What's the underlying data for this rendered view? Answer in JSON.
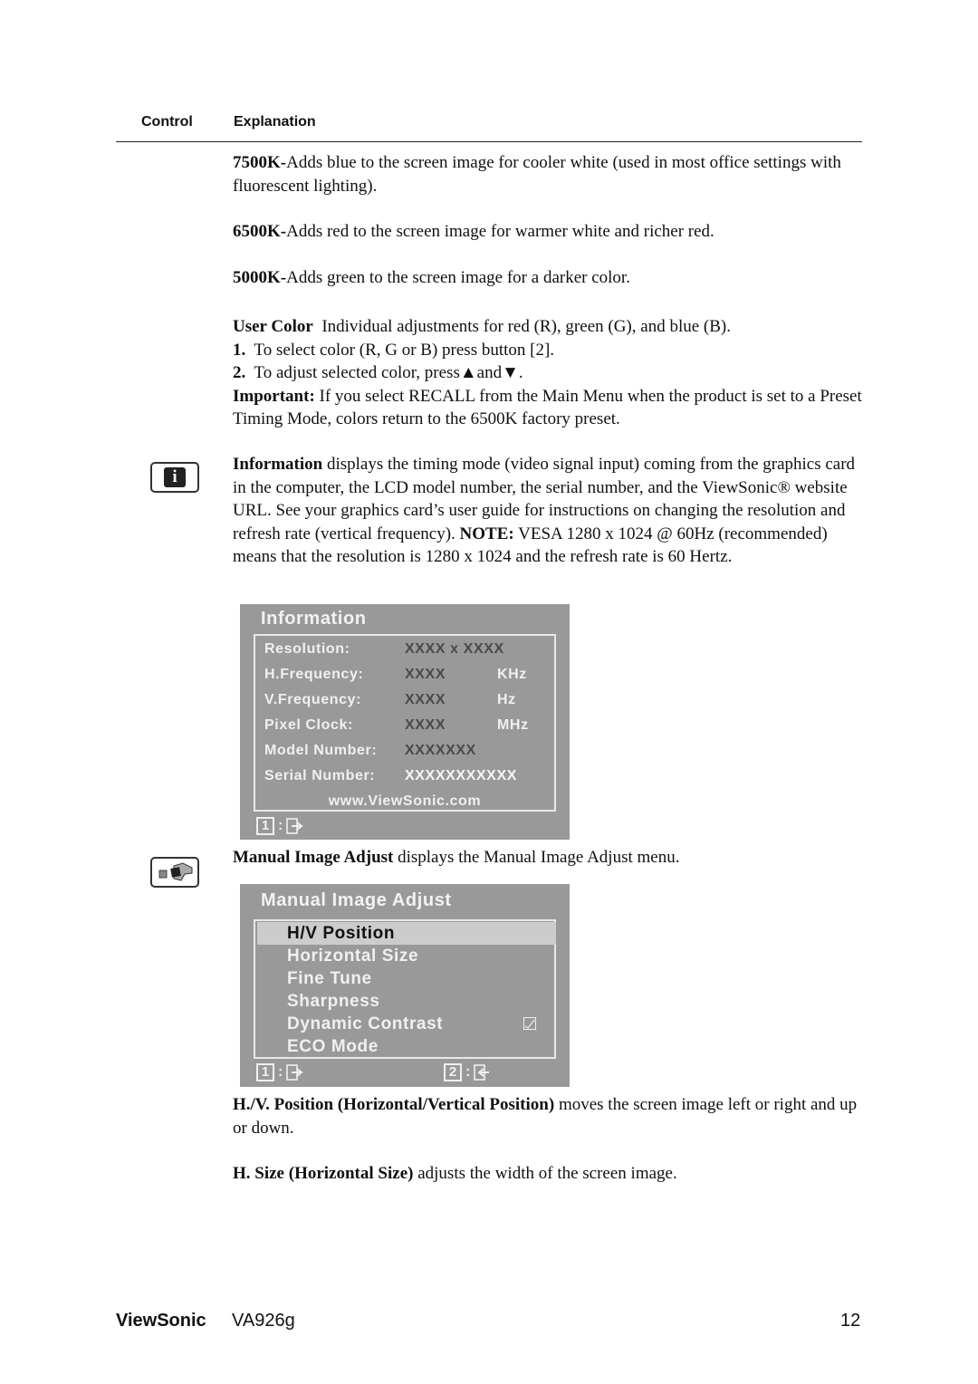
{
  "table_header": {
    "control": "Control",
    "explanation": "Explanation"
  },
  "color_presets": [
    {
      "label": "7500K-",
      "text": "Adds blue to the screen image for cooler white (used in most office settings with fluorescent lighting)."
    },
    {
      "label": "6500K-",
      "text": "Adds red to the screen image for warmer white and richer red."
    },
    {
      "label": "5000K-",
      "text": "Adds green to the screen image for a darker color."
    }
  ],
  "user_color": {
    "label": "User Color",
    "text": "Individual adjustments for red (R), green (G),  and blue (B).",
    "steps": [
      {
        "num": "1.",
        "text": "To select color (R, G or B) press button [2]."
      },
      {
        "num": "2.",
        "text": "To adjust selected color, press▲and▼."
      }
    ],
    "important_label": "Important:",
    "important_text": "If you select RECALL from the Main Menu when the product is set to a Preset Timing Mode, colors return to the 6500K factory preset."
  },
  "information": {
    "label": "Information",
    "text": "displays the timing mode (video signal input) coming from the graphics card in the computer, the LCD model number, the serial number, and the ViewSonic® website URL. See your graphics card’s user guide for instructions on changing the resolution and refresh rate (vertical frequency).",
    "note_label": "NOTE:",
    "note_text": "VESA 1280 x 1024 @ 60Hz (recommended) means that the resolution is 1280 x 1024 and the refresh rate is 60 Hertz.",
    "icon": "info-icon"
  },
  "info_osd": {
    "title": "Information",
    "rows": [
      {
        "label": "Resolution:",
        "value": "XXXX x XXXX",
        "unit": ""
      },
      {
        "label": "H.Frequency:",
        "value": "XXXX",
        "unit": "KHz"
      },
      {
        "label": "V.Frequency:",
        "value": "XXXX",
        "unit": "Hz"
      },
      {
        "label": "Pixel Clock:",
        "value": "XXXX",
        "unit": "MHz"
      },
      {
        "label": "Model Number:",
        "value": "XXXXXXX",
        "unit": ""
      },
      {
        "label": "Serial Number:",
        "value": "XXXXXXXXXXX",
        "unit": ""
      }
    ],
    "url": "www.ViewSonic.com",
    "footer_key": "1",
    "footer_sep": ":",
    "footer_icon": "exit-icon"
  },
  "manual_image_adjust": {
    "label": "Manual Image Adjust",
    "text": "displays the Manual Image Adjust menu.",
    "icon": "wrench-icon"
  },
  "mia_osd": {
    "title": "Manual Image Adjust",
    "items": [
      {
        "label": "H/V Position",
        "selected": true,
        "checkbox": false
      },
      {
        "label": "Horizontal Size",
        "selected": false,
        "checkbox": false
      },
      {
        "label": "Fine Tune",
        "selected": false,
        "checkbox": false
      },
      {
        "label": "Sharpness",
        "selected": false,
        "checkbox": false
      },
      {
        "label": "Dynamic Contrast",
        "selected": false,
        "checkbox": true
      },
      {
        "label": "ECO Mode",
        "selected": false,
        "checkbox": false
      }
    ],
    "footer": [
      {
        "key": "1",
        "sep": ":",
        "icon": "exit-icon"
      },
      {
        "key": "2",
        "sep": ":",
        "icon": "enter-icon"
      }
    ]
  },
  "hv_position": {
    "label": "H./V. Position (Horizontal/Vertical Position)",
    "text": "moves the screen image left or right and up or down."
  },
  "h_size": {
    "label": "H. Size (Horizontal Size)",
    "text": "adjusts the width of the screen image."
  },
  "footer": {
    "brand": "ViewSonic",
    "model": "VA926g",
    "page": "12"
  }
}
